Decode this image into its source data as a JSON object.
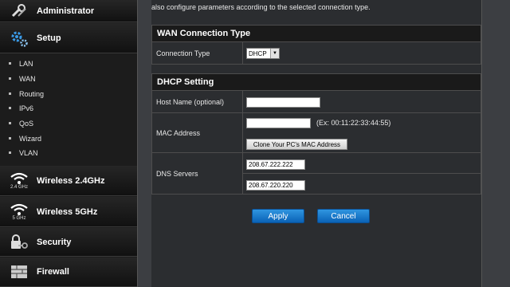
{
  "sidebar": {
    "administrator": "Administrator",
    "setup": "Setup",
    "items": [
      {
        "label": "LAN"
      },
      {
        "label": "WAN"
      },
      {
        "label": "Routing"
      },
      {
        "label": "IPv6"
      },
      {
        "label": "QoS"
      },
      {
        "label": "Wizard"
      },
      {
        "label": "VLAN"
      }
    ],
    "wireless24": {
      "label": "Wireless 2.4GHz",
      "sub": "2.4 GHz"
    },
    "wireless5": {
      "label": "Wireless 5GHz",
      "sub": "5 GHz"
    },
    "security": "Security",
    "firewall": "Firewall"
  },
  "main": {
    "intro": "also configure parameters according to the selected connection type.",
    "wan": {
      "title": "WAN Connection Type",
      "label": "Connection Type",
      "value": "DHCP"
    },
    "dhcp": {
      "title": "DHCP Setting",
      "host_label": "Host Name (optional)",
      "host_value": "",
      "mac_label": "MAC Address",
      "mac_value": "",
      "mac_hint": "(Ex: 00:11:22:33:44:55)",
      "clone_label": "Clone Your PC's MAC Address",
      "dns_label": "DNS Servers",
      "dns1": "208.67.222.222",
      "dns2": "208.67.220.220"
    },
    "apply": "Apply",
    "cancel": "Cancel"
  },
  "colors": {
    "accent": "#1a7fd4",
    "sidebar_bg": "#1c1c1c",
    "panel_bg": "#2b2d30"
  }
}
